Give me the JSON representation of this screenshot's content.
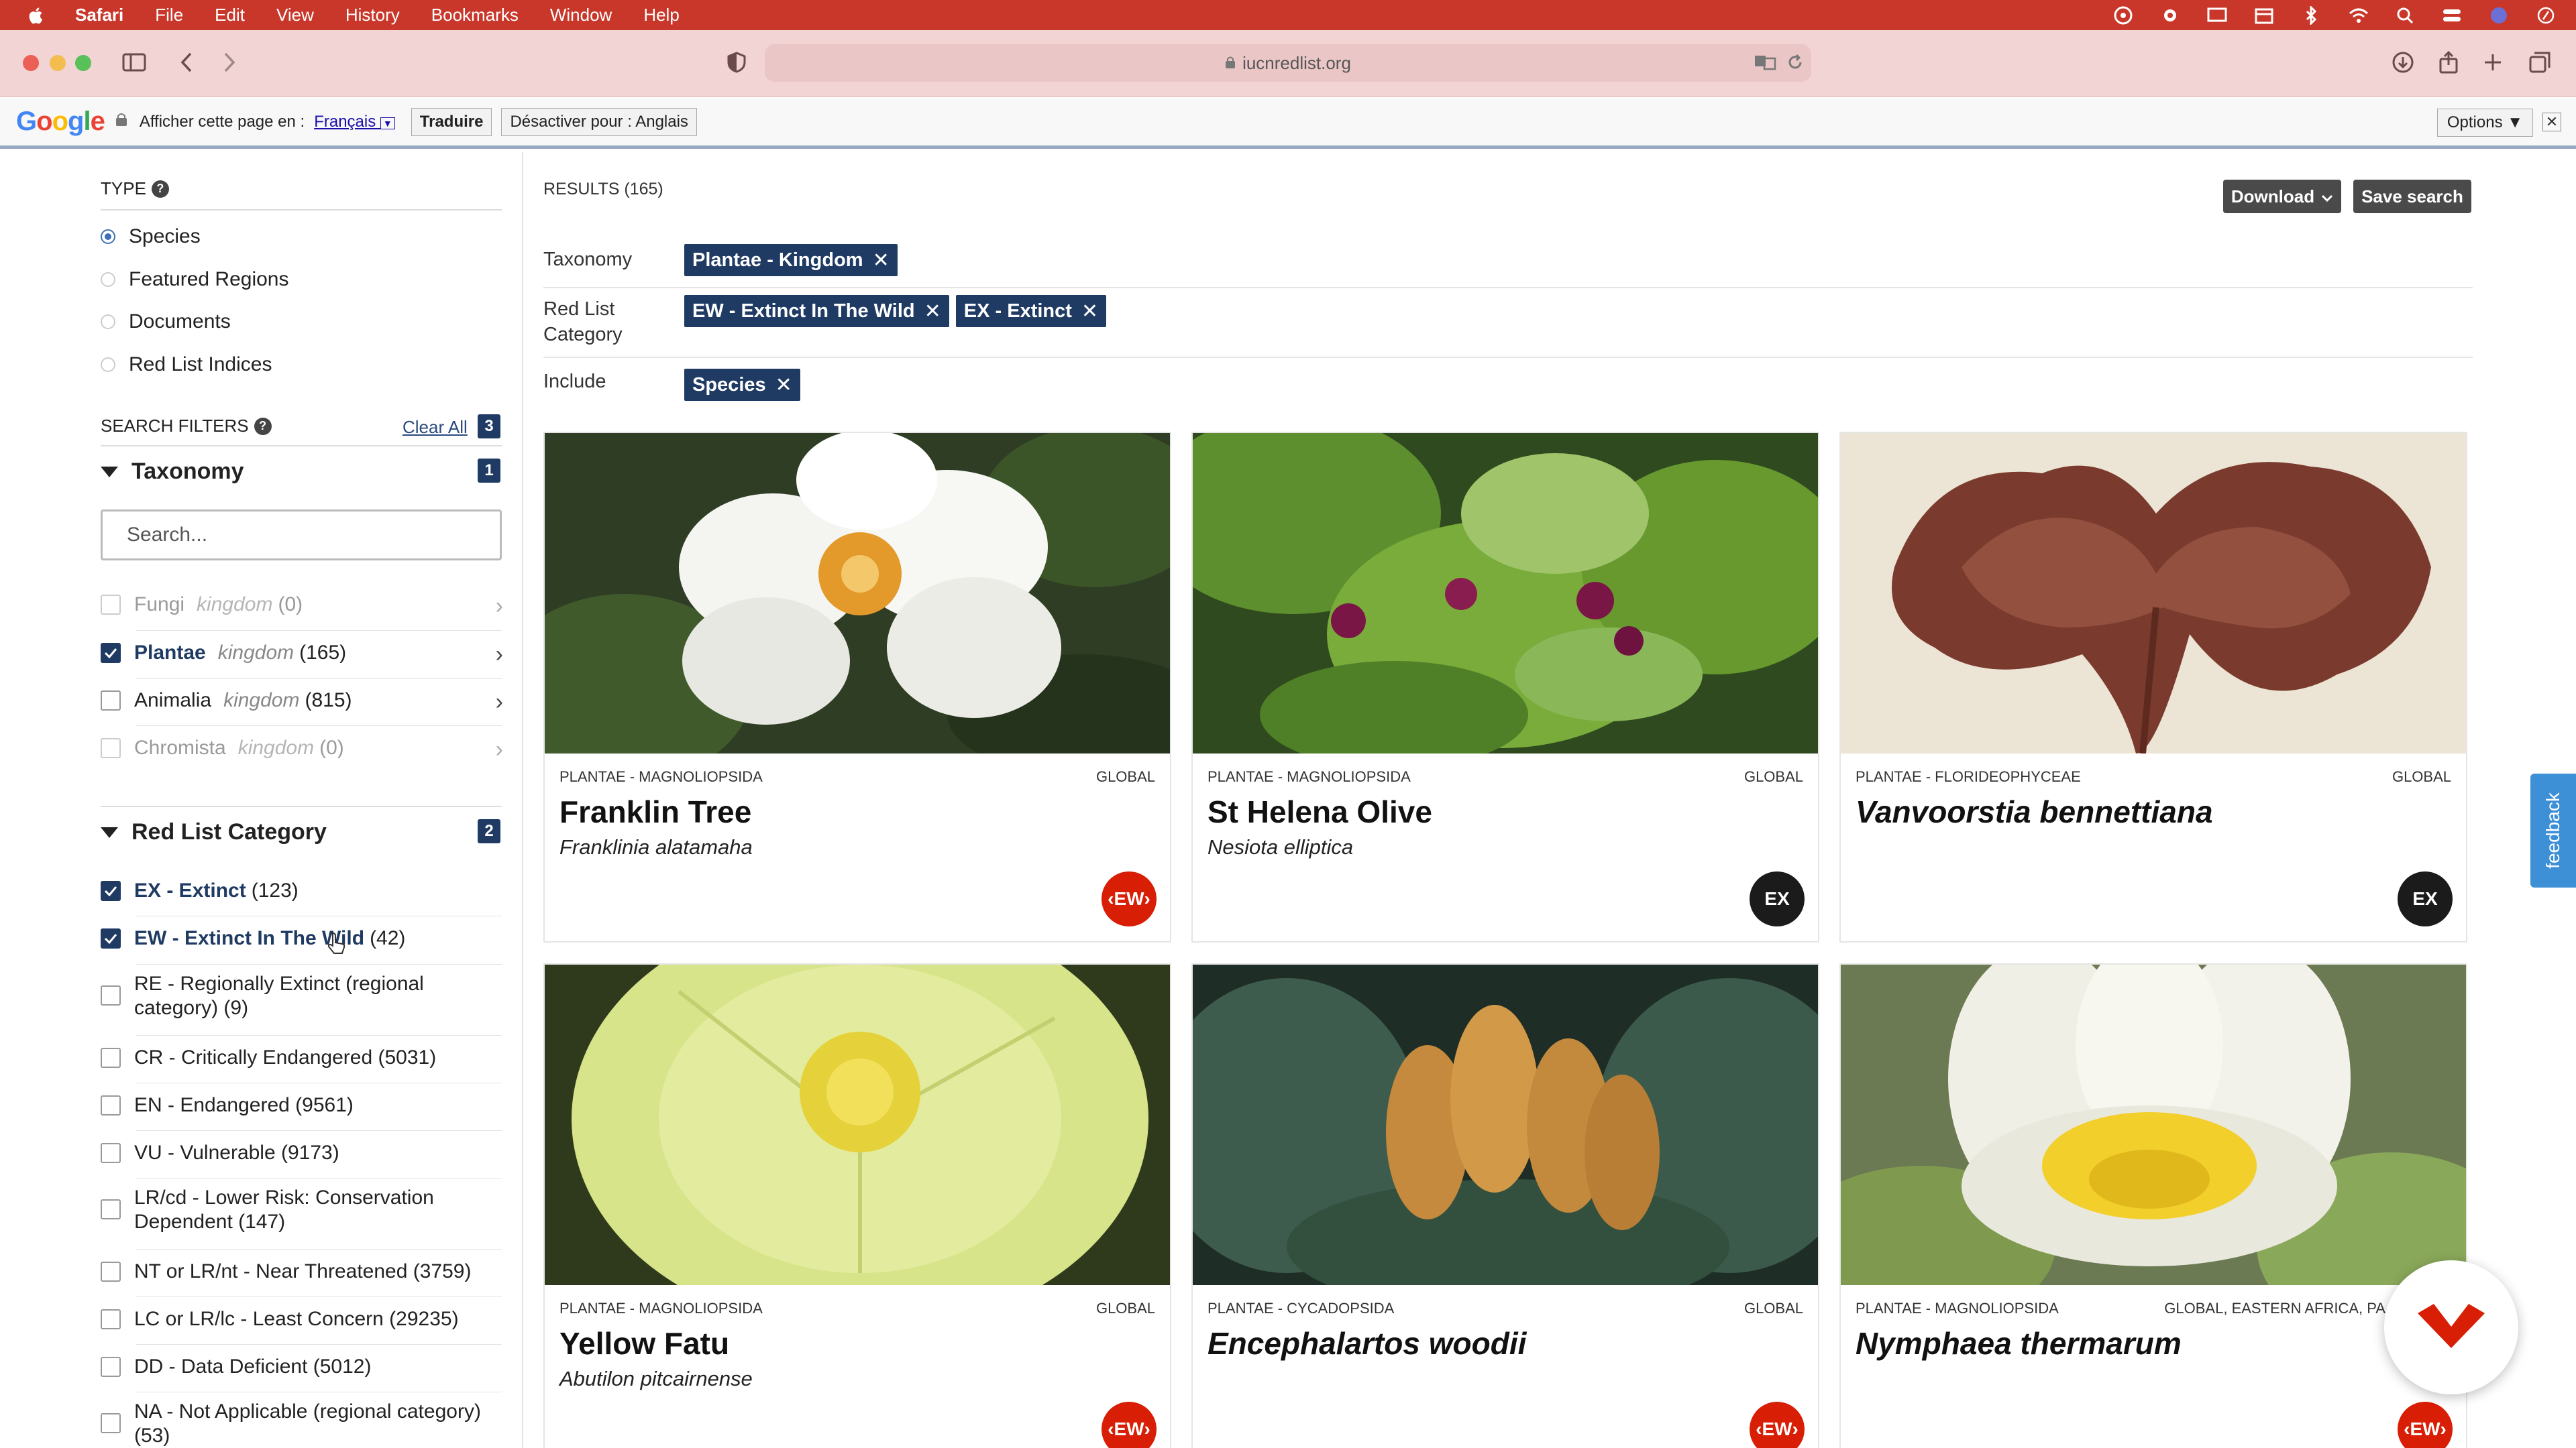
{
  "menubar": {
    "app": "Safari",
    "items": [
      "File",
      "Edit",
      "View",
      "History",
      "Bookmarks",
      "Window",
      "Help"
    ]
  },
  "browser": {
    "url": "iucnredlist.org"
  },
  "translate_bar": {
    "logo": [
      "G",
      "o",
      "o",
      "g",
      "l",
      "e"
    ],
    "prompt": "Afficher cette page en :",
    "language": "Français",
    "translate_button": "Traduire",
    "disable_button": "Désactiver pour : Anglais",
    "options_button": "Options ▼",
    "close": "✕"
  },
  "sidebar": {
    "type_heading": "TYPE",
    "type_options": [
      {
        "label": "Species",
        "selected": true
      },
      {
        "label": "Featured Regions",
        "selected": false
      },
      {
        "label": "Documents",
        "selected": false
      },
      {
        "label": "Red List Indices",
        "selected": false
      }
    ],
    "filters_heading": "SEARCH FILTERS",
    "clear_all": "Clear All",
    "filters_count": "3",
    "taxonomy": {
      "title": "Taxonomy",
      "count": "1",
      "search_placeholder": "Search...",
      "items": [
        {
          "name": "Fungi",
          "rank": "kingdom",
          "count": "(0)",
          "checked": false,
          "muted": true
        },
        {
          "name": "Plantae",
          "rank": "kingdom",
          "count": "(165)",
          "checked": true,
          "muted": false
        },
        {
          "name": "Animalia",
          "rank": "kingdom",
          "count": "(815)",
          "checked": false,
          "muted": false
        },
        {
          "name": "Chromista",
          "rank": "kingdom",
          "count": "(0)",
          "checked": false,
          "muted": true
        }
      ]
    },
    "redlist": {
      "title": "Red List Category",
      "count": "2",
      "items": [
        {
          "label": "EX - Extinct",
          "count": "(123)",
          "checked": true
        },
        {
          "label": "EW - Extinct In The Wild",
          "count": "(42)",
          "checked": true
        },
        {
          "label": "RE - Regionally Extinct (regional",
          "label2": "category) (9)",
          "checked": false
        },
        {
          "label": "CR - Critically Endangered (5031)",
          "checked": false
        },
        {
          "label": "EN - Endangered (9561)",
          "checked": false
        },
        {
          "label": "VU - Vulnerable (9173)",
          "checked": false
        },
        {
          "label": "LR/cd - Lower Risk: Conservation",
          "label2": "Dependent (147)",
          "checked": false
        },
        {
          "label": "NT or LR/nt - Near Threatened (3759)",
          "checked": false
        },
        {
          "label": "LC or LR/lc - Least Concern (29235)",
          "checked": false
        },
        {
          "label": "DD - Data Deficient (5012)",
          "checked": false
        },
        {
          "label": "NA - Not Applicable (regional category)",
          "label2": "(53)",
          "checked": false
        }
      ]
    }
  },
  "main": {
    "results_label": "RESULTS (165)",
    "download_button": "Download",
    "save_button": "Save search",
    "active_filters": [
      {
        "label": "Taxonomy",
        "chips": [
          "Plantae - Kingdom"
        ]
      },
      {
        "label": "Red List Category",
        "chips": [
          "EW - Extinct In The Wild",
          "EX - Extinct"
        ]
      },
      {
        "label": "Include",
        "chips": [
          "Species"
        ]
      }
    ],
    "cards": [
      {
        "taxon": "PLANTAE - MAGNOLIOPSIDA",
        "scope": "GLOBAL",
        "common_name": "Franklin Tree",
        "scientific_name": "Franklinia alatamaha",
        "status": "EW"
      },
      {
        "taxon": "PLANTAE - MAGNOLIOPSIDA",
        "scope": "GLOBAL",
        "common_name": "St Helena Olive",
        "scientific_name": "Nesiota elliptica",
        "status": "EX"
      },
      {
        "taxon": "PLANTAE - FLORIDEOPHYCEAE",
        "scope": "GLOBAL",
        "common_name": "Vanvoorstia bennettiana",
        "scientific_name": "",
        "status": "EX"
      },
      {
        "taxon": "PLANTAE - MAGNOLIOPSIDA",
        "scope": "GLOBAL",
        "common_name": "Yellow Fatu",
        "scientific_name": "Abutilon pitcairnense",
        "status": "EW"
      },
      {
        "taxon": "PLANTAE - CYCADOPSIDA",
        "scope": "GLOBAL",
        "common_name": "Encephalartos woodii",
        "scientific_name": "",
        "status": "EW"
      },
      {
        "taxon": "PLANTAE - MAGNOLIOPSIDA",
        "scope": "GLOBAL, EASTERN AFRICA, PA",
        "common_name": "Nymphaea thermarum",
        "scientific_name": "",
        "status": "EW"
      }
    ]
  },
  "feedback_tab": "feedback",
  "colors": {
    "menubar": "#c8372a",
    "chip": "#1f3a63",
    "ew": "#d81e05",
    "ex": "#1b1b1b"
  }
}
